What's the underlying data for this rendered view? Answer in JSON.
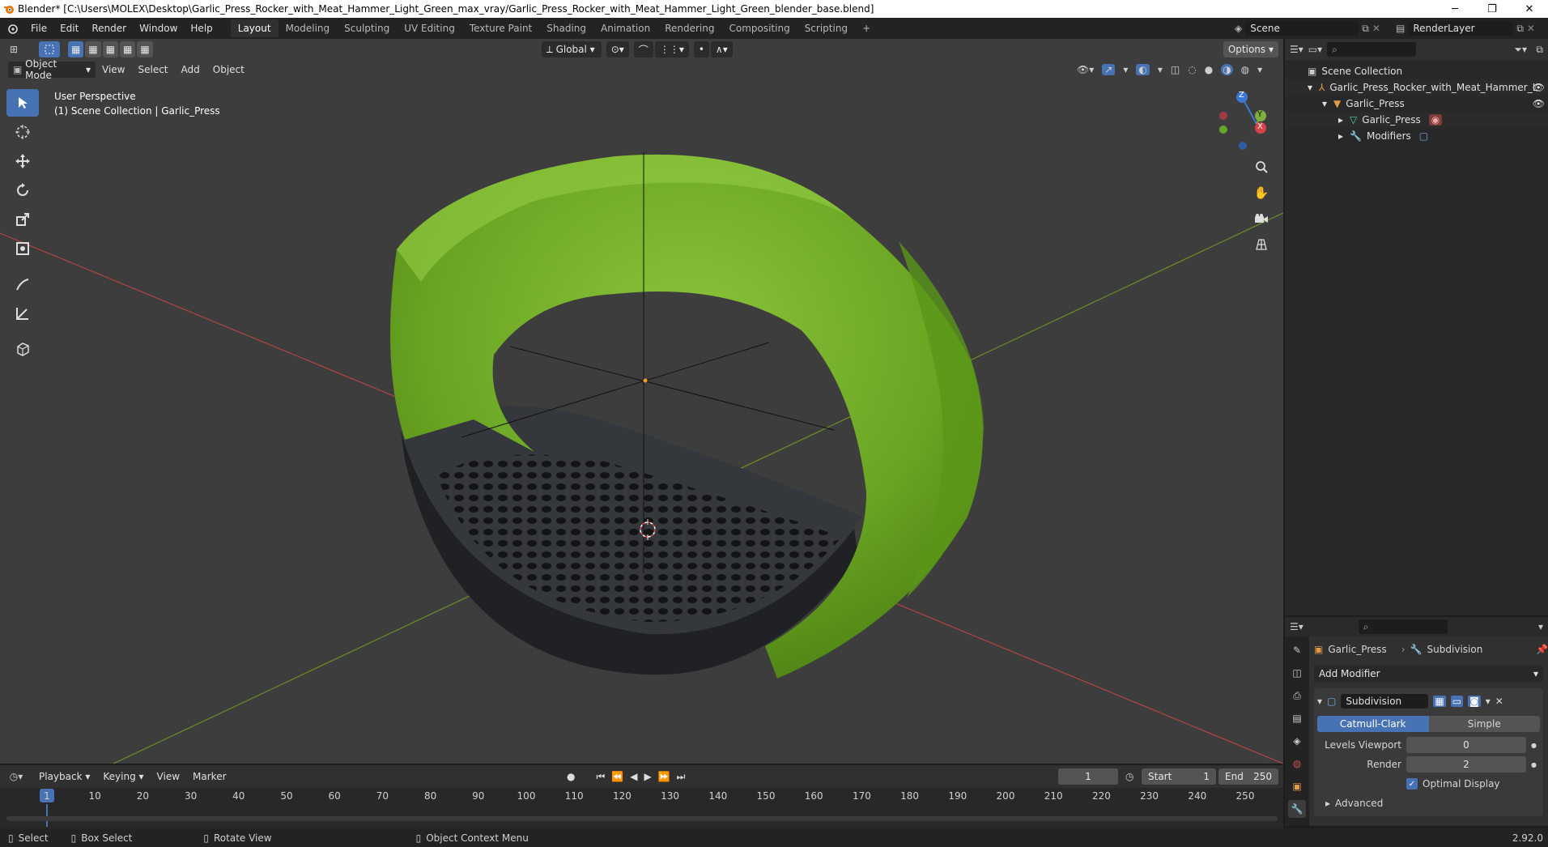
{
  "window": {
    "title": "Blender* [C:\\Users\\MOLEX\\Desktop\\Garlic_Press_Rocker_with_Meat_Hammer_Light_Green_max_vray/Garlic_Press_Rocker_with_Meat_Hammer_Light_Green_blender_base.blend]"
  },
  "menu": [
    "File",
    "Edit",
    "Render",
    "Window",
    "Help"
  ],
  "workspaces": [
    "Layout",
    "Modeling",
    "Sculpting",
    "UV Editing",
    "Texture Paint",
    "Shading",
    "Animation",
    "Rendering",
    "Compositing",
    "Scripting"
  ],
  "active_workspace": "Layout",
  "scene": {
    "scene_name": "Scene",
    "render_layer": "RenderLayer"
  },
  "viewport": {
    "mode": "Object Mode",
    "menus": [
      "View",
      "Select",
      "Add",
      "Object"
    ],
    "transform_orientation": "Global",
    "options_label": "Options",
    "perspective": "User Perspective",
    "collection_info": "(1) Scene Collection | Garlic_Press",
    "gizmo_axes": {
      "x": "X",
      "y": "Y",
      "z": "Z"
    },
    "colors": {
      "object_green": "#6faa24",
      "grater": "#2c2f33",
      "x_axis": "#c04848",
      "y_axis": "#7a9c2a"
    }
  },
  "outliner": {
    "rows": [
      {
        "label": "Scene Collection",
        "indent": 0
      },
      {
        "label": "Garlic_Press_Rocker_with_Meat_Hammer_L",
        "indent": 1
      },
      {
        "label": "Garlic_Press",
        "indent": 2
      },
      {
        "label": "Garlic_Press",
        "indent": 3
      },
      {
        "label": "Modifiers",
        "indent": 3
      }
    ]
  },
  "properties": {
    "object_name": "Garlic_Press",
    "modifier_tab": "Subdivision",
    "add_modifier": "Add Modifier",
    "modifier_name": "Subdivision",
    "mode_catmull": "Catmull-Clark",
    "mode_simple": "Simple",
    "levels_viewport_label": "Levels Viewport",
    "levels_viewport_value": "0",
    "render_label": "Render",
    "render_value": "2",
    "optimal_display": "Optimal Display",
    "advanced": "Advanced"
  },
  "timeline": {
    "menus": [
      "Playback",
      "Keying",
      "View",
      "Marker"
    ],
    "current_frame": "1",
    "start_label": "Start",
    "start_value": "1",
    "end_label": "End",
    "end_value": "250",
    "ruler": [
      "10",
      "20",
      "30",
      "40",
      "50",
      "60",
      "70",
      "80",
      "90",
      "100",
      "110",
      "120",
      "130",
      "140",
      "150",
      "160",
      "170",
      "180",
      "190",
      "200",
      "210",
      "220",
      "230",
      "240",
      "250"
    ],
    "cursor_label": "1"
  },
  "statusbar": {
    "select": "Select",
    "box_select": "Box Select",
    "rotate_view": "Rotate View",
    "context_menu": "Object Context Menu",
    "version": "2.92.0"
  }
}
